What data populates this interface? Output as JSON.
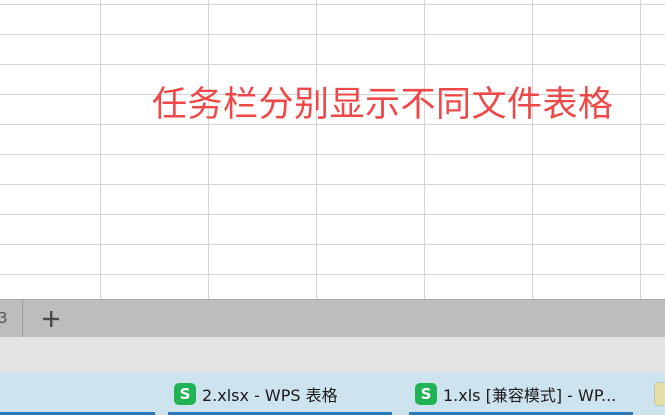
{
  "spreadsheet": {
    "overlay_text": "任务栏分别显示不同文件表格"
  },
  "sheet_bar": {
    "partial_tab_label": "3",
    "add_sheet_symbol": "+"
  },
  "taskbar": {
    "items": [
      {
        "label": "2.xlsx - WPS 表格",
        "icon": "wps-spreadsheet-icon",
        "icon_letter": "S"
      },
      {
        "label": "1.xls [兼容模式] - WP...",
        "icon": "wps-spreadsheet-icon",
        "icon_letter": "S"
      }
    ]
  },
  "colors": {
    "overlay_text": "#f04848",
    "wps_icon": "#1fb356",
    "taskbar_bg": "#cde3ee",
    "taskbar_active_underline": "#2b79b8",
    "sheet_bar_bg": "#bdbdbd"
  }
}
